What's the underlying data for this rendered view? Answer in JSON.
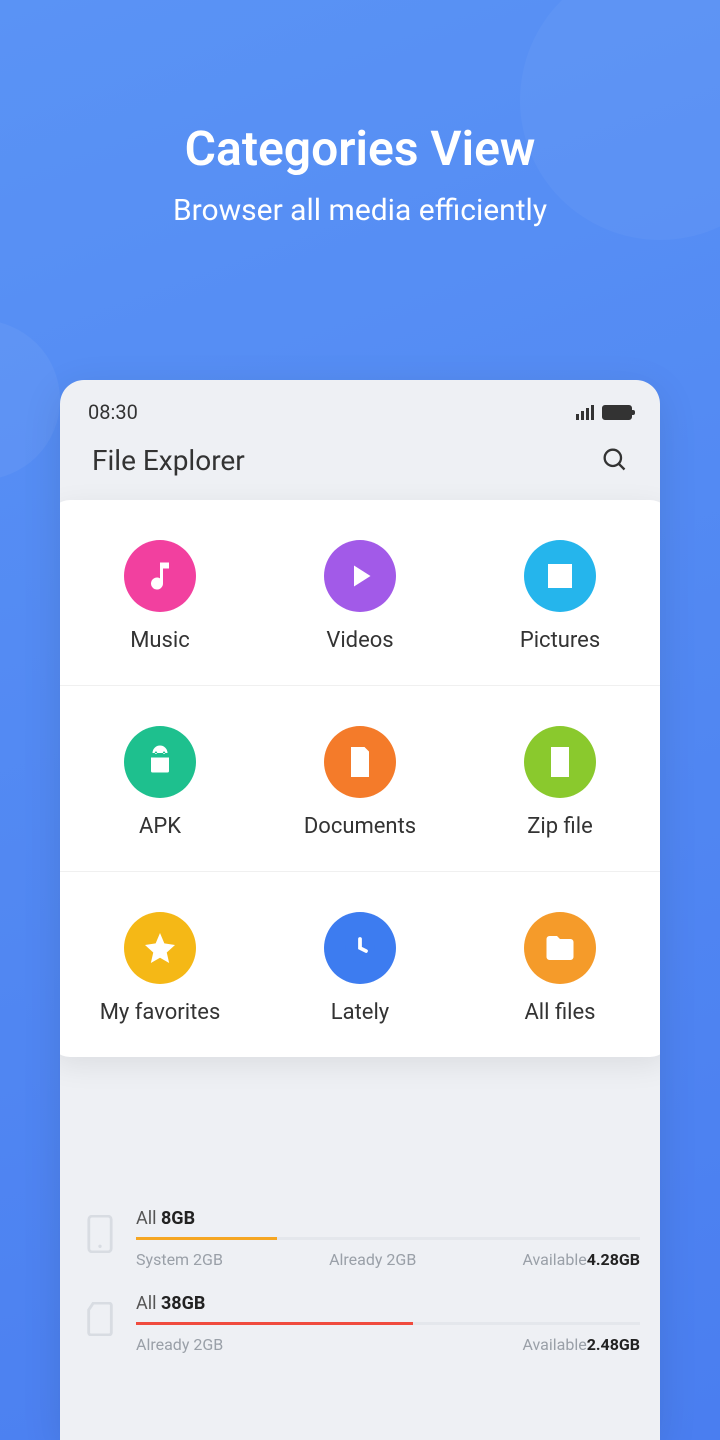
{
  "promo": {
    "title": "Categories View",
    "subtitle": "Browser all media efficiently"
  },
  "statusbar": {
    "time": "08:30"
  },
  "header": {
    "title": "File Explorer"
  },
  "categories": [
    {
      "label": "Music",
      "color": "#f2409f",
      "icon": "music"
    },
    {
      "label": "Videos",
      "color": "#a25ae8",
      "icon": "play"
    },
    {
      "label": "Pictures",
      "color": "#25b5ec",
      "icon": "picture"
    },
    {
      "label": "APK",
      "color": "#1ec08e",
      "icon": "android"
    },
    {
      "label": "Documents",
      "color": "#f47b2a",
      "icon": "document"
    },
    {
      "label": "Zip file",
      "color": "#8ac92d",
      "icon": "zip"
    },
    {
      "label": "My favorites",
      "color": "#f5b816",
      "icon": "star"
    },
    {
      "label": "Lately",
      "color": "#3d7cf0",
      "icon": "clock"
    },
    {
      "label": "All files",
      "color": "#f59b2a",
      "icon": "folder"
    }
  ],
  "storage": [
    {
      "all_label": "All ",
      "all_value": "8GB",
      "fill_color": "#f5a623",
      "fill_pct": 28,
      "left": "System 2GB",
      "mid": "Already 2GB",
      "right_label": "Available",
      "right_value": "4.28GB"
    },
    {
      "all_label": "All ",
      "all_value": "38GB",
      "fill_color": "#f04b3e",
      "fill_pct": 55,
      "left": "Already 2GB",
      "mid": "",
      "right_label": "Available",
      "right_value": "2.48GB"
    }
  ]
}
